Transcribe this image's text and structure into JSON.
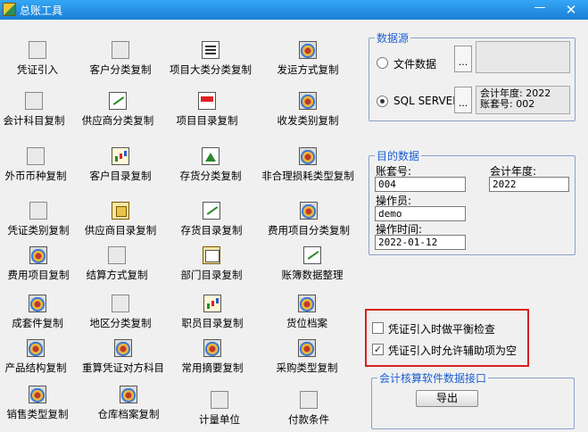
{
  "window": {
    "title": "总账工具",
    "minimize_glyph": "—",
    "close_glyph": "✕"
  },
  "tools": [
    [
      "凭证引入",
      "客户分类复制",
      "项目大类分类复制",
      "发运方式复制"
    ],
    [
      "会计科目复制",
      "供应商分类复制",
      "项目目录复制",
      "收发类别复制"
    ],
    [
      "外币币种复制",
      "客户目录复制",
      "存货分类复制",
      "非合理损耗类型复制"
    ],
    [
      "凭证类别复制",
      "供应商目录复制",
      "存货目录复制",
      "费用项目分类复制"
    ],
    [
      "费用项目复制",
      "结算方式复制",
      "部门目录复制",
      "账簿数据整理"
    ],
    [
      "成套件复制",
      "地区分类复制",
      "职员目录复制",
      "货位档案"
    ],
    [
      "产品结构复制",
      "重算凭证对方科目",
      "常用摘要复制",
      "采购类型复制"
    ],
    [
      "销售类型复制",
      "仓库档案复制",
      "计量单位",
      "付款条件"
    ]
  ],
  "data_source": {
    "legend": "数据源",
    "file_option": "文件数据",
    "sql_option": "SQL SERVER",
    "dots": "...",
    "fiscal_year_line": "会计年度: 2022",
    "account_set_line": "账套号: 002"
  },
  "target": {
    "legend": "目的数据",
    "account_set_label": "账套号:",
    "account_set_value": "004",
    "fiscal_year_label": "会计年度:",
    "fiscal_year_value": "2022",
    "operator_label": "操作员:",
    "operator_value": "demo",
    "op_time_label": "操作时间:",
    "op_time_value": "2022-01-12"
  },
  "options": {
    "balance_check_label": "凭证引入时做平衡检查",
    "allow_aux_empty_label": "凭证引入时允许辅助项为空",
    "check_glyph": "✓"
  },
  "interface": {
    "legend": "会计核算软件数据接口",
    "export_label": "导出"
  },
  "colors": {
    "accent": "#1a5fd0",
    "highlight_frame": "#d92020",
    "titlebar": "#1a7fd6"
  }
}
